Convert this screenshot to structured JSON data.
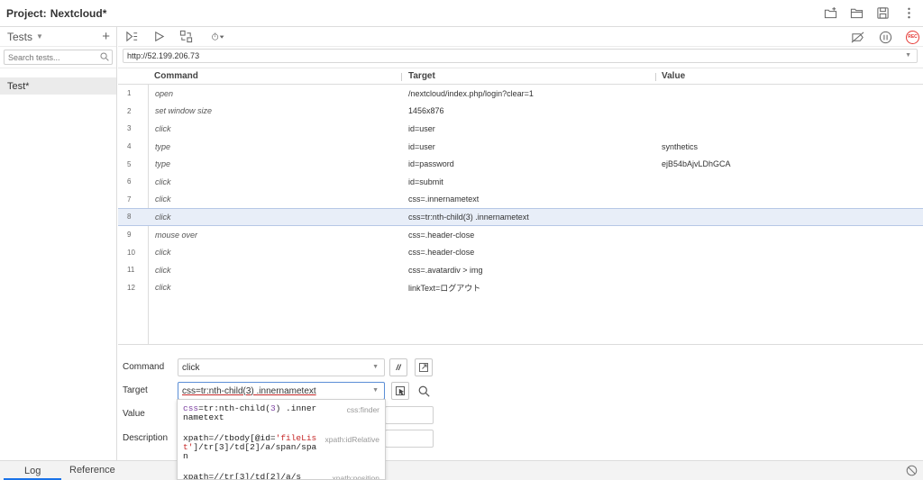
{
  "project": {
    "label": "Project:",
    "name": "Nextcloud*"
  },
  "sidebar": {
    "tests_label": "Tests",
    "search_placeholder": "Search tests...",
    "items": [
      {
        "label": "Test*"
      }
    ]
  },
  "url": {
    "value": "http://52.199.206.73"
  },
  "table": {
    "headers": {
      "command": "Command",
      "target": "Target",
      "value": "Value"
    },
    "selected_row": 8,
    "rows": [
      {
        "num": "1",
        "command": "open",
        "target": "/nextcloud/index.php/login?clear=1",
        "value": ""
      },
      {
        "num": "2",
        "command": "set window size",
        "target": "1456x876",
        "value": ""
      },
      {
        "num": "3",
        "command": "click",
        "target": "id=user",
        "value": ""
      },
      {
        "num": "4",
        "command": "type",
        "target": "id=user",
        "value": "synthetics"
      },
      {
        "num": "5",
        "command": "type",
        "target": "id=password",
        "value": "ejB54bAjvLDhGCA"
      },
      {
        "num": "6",
        "command": "click",
        "target": "id=submit",
        "value": ""
      },
      {
        "num": "7",
        "command": "click",
        "target": "css=.innernametext",
        "value": ""
      },
      {
        "num": "8",
        "command": "click",
        "target": "css=tr:nth-child(3) .innernametext",
        "value": ""
      },
      {
        "num": "9",
        "command": "mouse over",
        "target": "css=.header-close",
        "value": ""
      },
      {
        "num": "10",
        "command": "click",
        "target": "css=.header-close",
        "value": ""
      },
      {
        "num": "11",
        "command": "click",
        "target": "css=.avatardiv > img",
        "value": ""
      },
      {
        "num": "12",
        "command": "click",
        "target": "linkText=ログアウト",
        "value": ""
      }
    ]
  },
  "editor": {
    "command_label": "Command",
    "command_value": "click",
    "comment_toggle": "//",
    "target_label": "Target",
    "target_value": "css=tr:nth-child(3) .innernametext",
    "value_label": "Value",
    "description_label": "Description"
  },
  "suggestions": [
    {
      "locator": "css=tr:nth-child(3) .innernametext",
      "kind": "css:finder"
    },
    {
      "locator": "xpath=//tbody[@id='fileList']/tr[3]/td[2]/a/span/span",
      "kind": "xpath:idRelative"
    },
    {
      "locator": "xpath=//tr[3]/td[2]/a/s",
      "kind": "xpath:position"
    }
  ],
  "bottom": {
    "log_tab": "Log",
    "reference_tab": "Reference"
  },
  "toolbar": {
    "record_label": "REC"
  },
  "colors": {
    "accent": "#1a73e8",
    "record": "#e53935",
    "selected_row": "#e8eef8"
  }
}
